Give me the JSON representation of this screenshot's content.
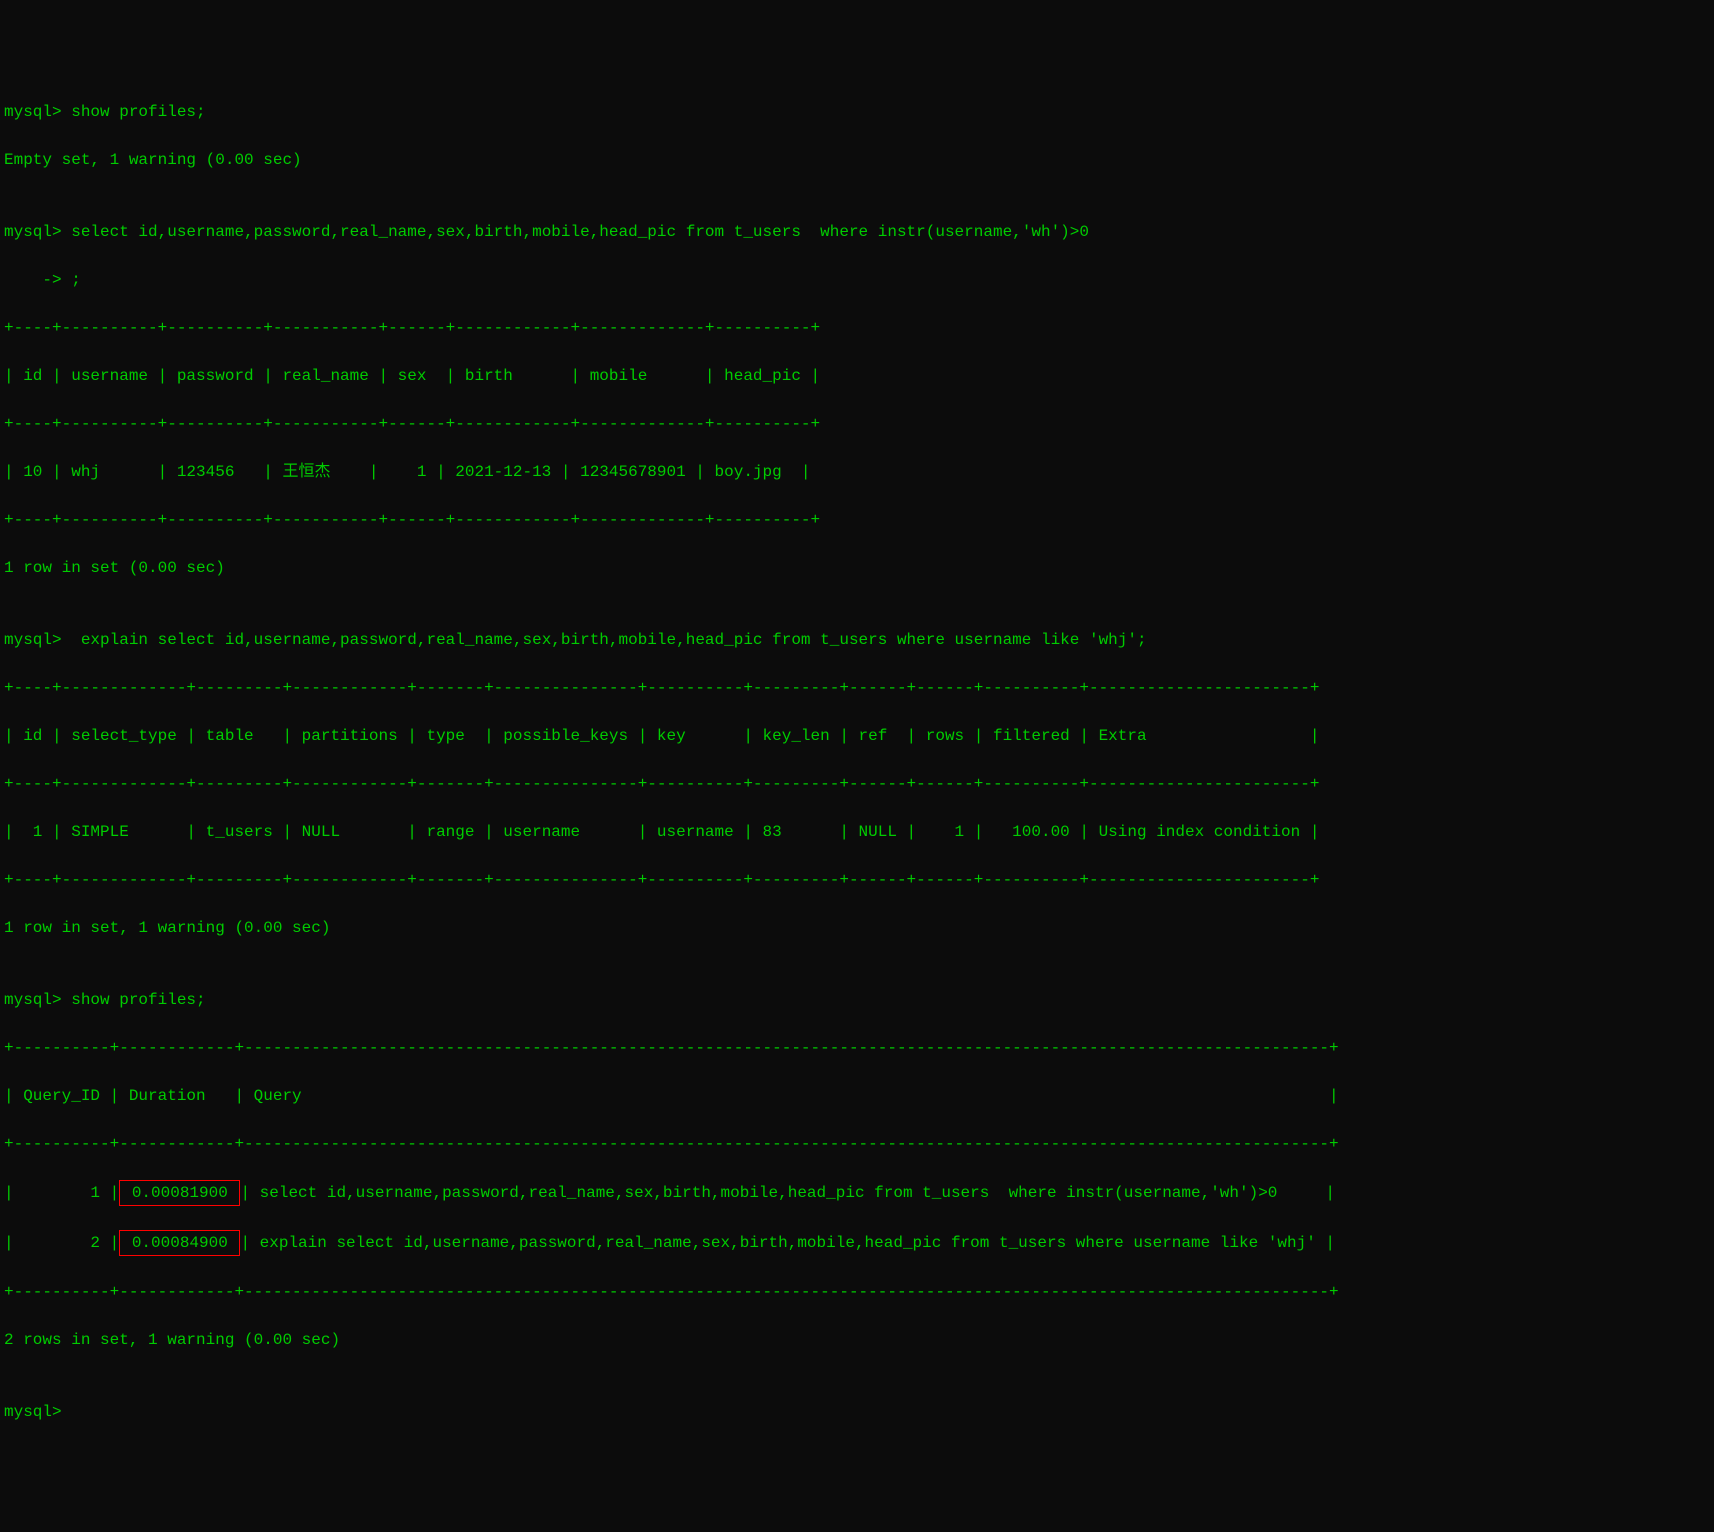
{
  "prompt": "mysql>",
  "continuation": "    ->",
  "lines": {
    "l1": "mysql> show profiles;",
    "l2": "Empty set, 1 warning (0.00 sec)",
    "l3": "",
    "l4": "mysql> select id,username,password,real_name,sex,birth,mobile,head_pic from t_users  where instr(username,'wh')>0",
    "l5": "    -> ;",
    "l6": "+----+----------+----------+-----------+------+------------+-------------+----------+",
    "l7": "| id | username | password | real_name | sex  | birth      | mobile      | head_pic |",
    "l8": "+----+----------+----------+-----------+------+------------+-------------+----------+",
    "l9": "| 10 | whj      | 123456   | 王恒杰    |    1 | 2021-12-13 | 12345678901 | boy.jpg  |",
    "l10": "+----+----------+----------+-----------+------+------------+-------------+----------+",
    "l11": "1 row in set (0.00 sec)",
    "l12": "",
    "l13": "mysql>  explain select id,username,password,real_name,sex,birth,mobile,head_pic from t_users where username like 'whj';",
    "l14": "+----+-------------+---------+------------+-------+---------------+----------+---------+------+------+----------+-----------------------+",
    "l15": "| id | select_type | table   | partitions | type  | possible_keys | key      | key_len | ref  | rows | filtered | Extra                 |",
    "l16": "+----+-------------+---------+------------+-------+---------------+----------+---------+------+------+----------+-----------------------+",
    "l17": "|  1 | SIMPLE      | t_users | NULL       | range | username      | username | 83      | NULL |    1 |   100.00 | Using index condition |",
    "l18": "+----+-------------+---------+------------+-------+---------------+----------+---------+------+------+----------+-----------------------+",
    "l19": "1 row in set, 1 warning (0.00 sec)",
    "l20": "",
    "l21": "mysql> show profiles;",
    "l22": "+----------+------------+-----------------------------------------------------------------------------------------------------------------+",
    "l23": "| Query_ID | Duration   | Query                                                                                                           |",
    "l24": "+----------+------------+-----------------------------------------------------------------------------------------------------------------+",
    "l25_pre": "|        1 |",
    "l25_highlight": " 0.00081900 ",
    "l25_post": "| select id,username,password,real_name,sex,birth,mobile,head_pic from t_users  where instr(username,'wh')>0     |",
    "l26_pre": "|        2 |",
    "l26_highlight": " 0.00084900 ",
    "l26_post": "| explain select id,username,password,real_name,sex,birth,mobile,head_pic from t_users where username like 'whj' |",
    "l27": "+----------+------------+-----------------------------------------------------------------------------------------------------------------+",
    "l28": "2 rows in set, 1 warning (0.00 sec)",
    "l29": "",
    "l30": "mysql>"
  },
  "tables": {
    "users_result": {
      "headers": [
        "id",
        "username",
        "password",
        "real_name",
        "sex",
        "birth",
        "mobile",
        "head_pic"
      ],
      "rows": [
        {
          "id": "10",
          "username": "whj",
          "password": "123456",
          "real_name": "王恒杰",
          "sex": "1",
          "birth": "2021-12-13",
          "mobile": "12345678901",
          "head_pic": "boy.jpg"
        }
      ]
    },
    "explain_result": {
      "headers": [
        "id",
        "select_type",
        "table",
        "partitions",
        "type",
        "possible_keys",
        "key",
        "key_len",
        "ref",
        "rows",
        "filtered",
        "Extra"
      ],
      "rows": [
        {
          "id": "1",
          "select_type": "SIMPLE",
          "table": "t_users",
          "partitions": "NULL",
          "type": "range",
          "possible_keys": "username",
          "key": "username",
          "key_len": "83",
          "ref": "NULL",
          "rows": "1",
          "filtered": "100.00",
          "Extra": "Using index condition"
        }
      ]
    },
    "profiles_result": {
      "headers": [
        "Query_ID",
        "Duration",
        "Query"
      ],
      "rows": [
        {
          "Query_ID": "1",
          "Duration": "0.00081900",
          "Query": "select id,username,password,real_name,sex,birth,mobile,head_pic from t_users  where instr(username,'wh')>0"
        },
        {
          "Query_ID": "2",
          "Duration": "0.00084900",
          "Query": "explain select id,username,password,real_name,sex,birth,mobile,head_pic from t_users where username like 'whj'"
        }
      ]
    }
  },
  "queries": {
    "q1": "show profiles;",
    "q2": "select id,username,password,real_name,sex,birth,mobile,head_pic from t_users  where instr(username,'wh')>0",
    "q3": "explain select id,username,password,real_name,sex,birth,mobile,head_pic from t_users where username like 'whj';",
    "q4": "show profiles;"
  },
  "status": {
    "s1": "Empty set, 1 warning (0.00 sec)",
    "s2": "1 row in set (0.00 sec)",
    "s3": "1 row in set, 1 warning (0.00 sec)",
    "s4": "2 rows in set, 1 warning (0.00 sec)"
  }
}
